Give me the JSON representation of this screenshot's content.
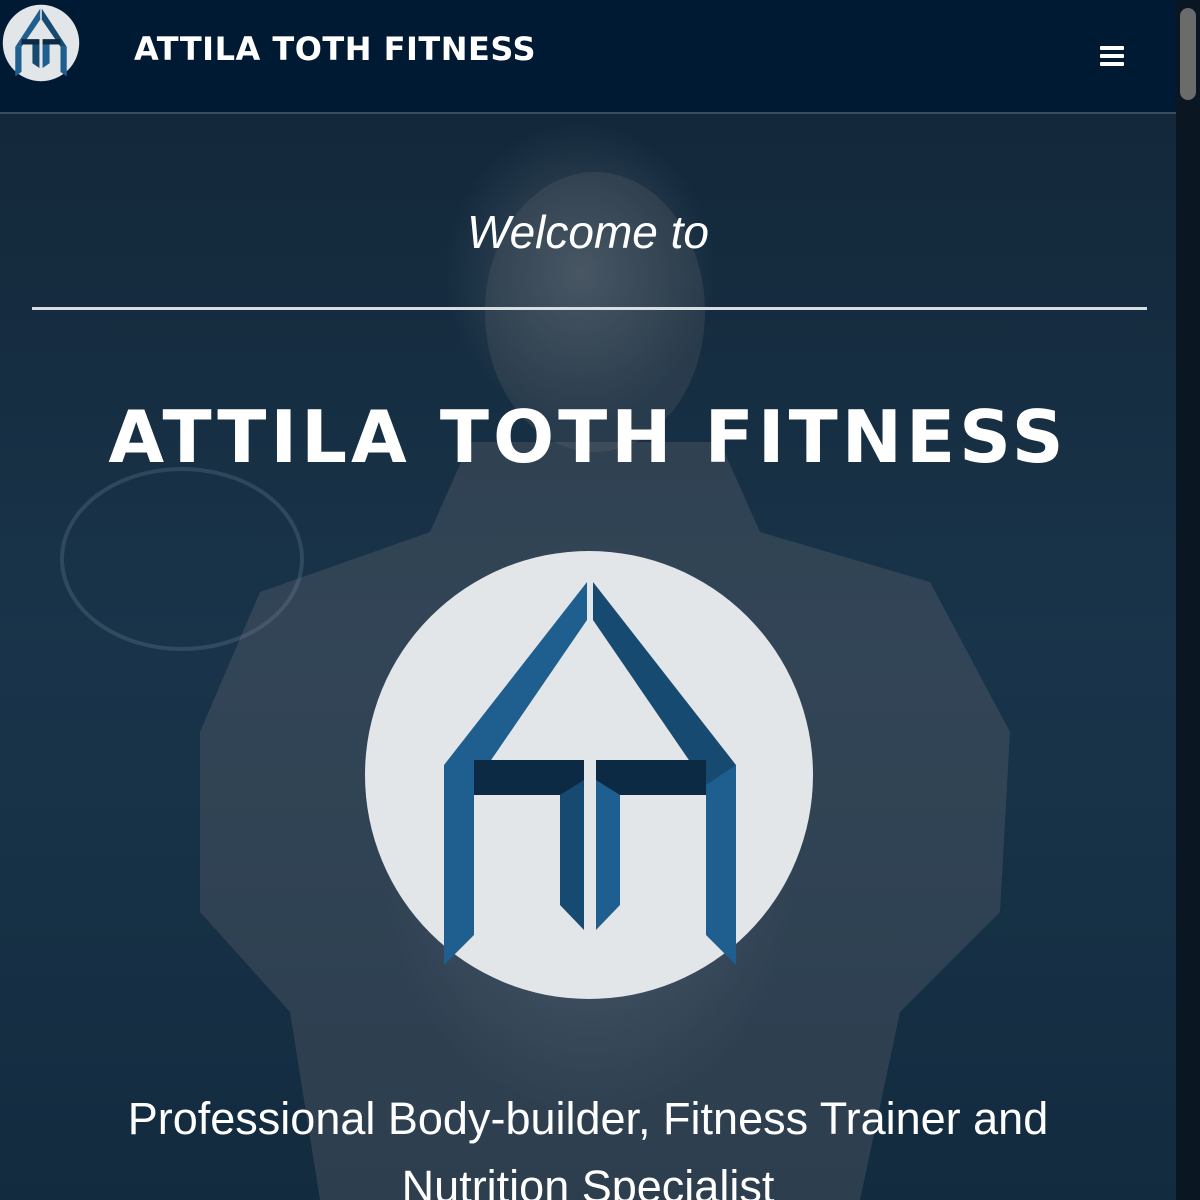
{
  "navbar": {
    "brand": "ATTILA TOTH FITNESS",
    "logo_icon": "atf-logo-icon",
    "menu_icon": "hamburger-menu-icon"
  },
  "hero": {
    "welcome": "Welcome to",
    "title": "ATTILA TOTH FITNESS",
    "subtitle": "Professional Body-builder, Fitness Trainer and Nutrition Specialist",
    "logo_icon": "atf-logo-icon"
  },
  "colors": {
    "navbar_bg": "#001a33",
    "logo_blue": "#1f5f8f",
    "logo_dark": "#0d2a45",
    "logo_circle": "#e3e6e9",
    "text": "#ffffff"
  }
}
